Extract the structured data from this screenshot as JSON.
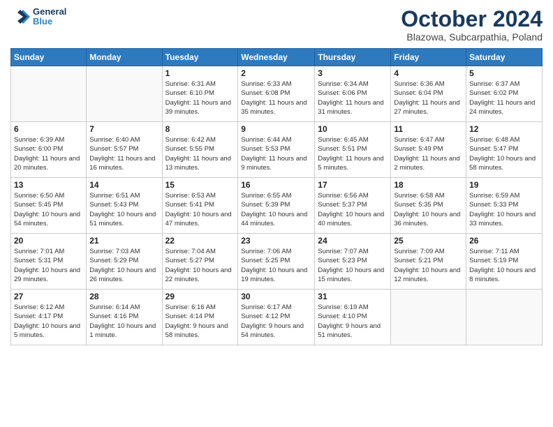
{
  "header": {
    "logo_line1": "General",
    "logo_line2": "Blue",
    "title": "October 2024",
    "location": "Blazowa, Subcarpathia, Poland"
  },
  "weekdays": [
    "Sunday",
    "Monday",
    "Tuesday",
    "Wednesday",
    "Thursday",
    "Friday",
    "Saturday"
  ],
  "weeks": [
    [
      {
        "day": "",
        "info": ""
      },
      {
        "day": "",
        "info": ""
      },
      {
        "day": "1",
        "info": "Sunrise: 6:31 AM\nSunset: 6:10 PM\nDaylight: 11 hours and 39 minutes."
      },
      {
        "day": "2",
        "info": "Sunrise: 6:33 AM\nSunset: 6:08 PM\nDaylight: 11 hours and 35 minutes."
      },
      {
        "day": "3",
        "info": "Sunrise: 6:34 AM\nSunset: 6:06 PM\nDaylight: 11 hours and 31 minutes."
      },
      {
        "day": "4",
        "info": "Sunrise: 6:36 AM\nSunset: 6:04 PM\nDaylight: 11 hours and 27 minutes."
      },
      {
        "day": "5",
        "info": "Sunrise: 6:37 AM\nSunset: 6:02 PM\nDaylight: 11 hours and 24 minutes."
      }
    ],
    [
      {
        "day": "6",
        "info": "Sunrise: 6:39 AM\nSunset: 6:00 PM\nDaylight: 11 hours and 20 minutes."
      },
      {
        "day": "7",
        "info": "Sunrise: 6:40 AM\nSunset: 5:57 PM\nDaylight: 11 hours and 16 minutes."
      },
      {
        "day": "8",
        "info": "Sunrise: 6:42 AM\nSunset: 5:55 PM\nDaylight: 11 hours and 13 minutes."
      },
      {
        "day": "9",
        "info": "Sunrise: 6:44 AM\nSunset: 5:53 PM\nDaylight: 11 hours and 9 minutes."
      },
      {
        "day": "10",
        "info": "Sunrise: 6:45 AM\nSunset: 5:51 PM\nDaylight: 11 hours and 5 minutes."
      },
      {
        "day": "11",
        "info": "Sunrise: 6:47 AM\nSunset: 5:49 PM\nDaylight: 11 hours and 2 minutes."
      },
      {
        "day": "12",
        "info": "Sunrise: 6:48 AM\nSunset: 5:47 PM\nDaylight: 10 hours and 58 minutes."
      }
    ],
    [
      {
        "day": "13",
        "info": "Sunrise: 6:50 AM\nSunset: 5:45 PM\nDaylight: 10 hours and 54 minutes."
      },
      {
        "day": "14",
        "info": "Sunrise: 6:51 AM\nSunset: 5:43 PM\nDaylight: 10 hours and 51 minutes."
      },
      {
        "day": "15",
        "info": "Sunrise: 6:53 AM\nSunset: 5:41 PM\nDaylight: 10 hours and 47 minutes."
      },
      {
        "day": "16",
        "info": "Sunrise: 6:55 AM\nSunset: 5:39 PM\nDaylight: 10 hours and 44 minutes."
      },
      {
        "day": "17",
        "info": "Sunrise: 6:56 AM\nSunset: 5:37 PM\nDaylight: 10 hours and 40 minutes."
      },
      {
        "day": "18",
        "info": "Sunrise: 6:58 AM\nSunset: 5:35 PM\nDaylight: 10 hours and 36 minutes."
      },
      {
        "day": "19",
        "info": "Sunrise: 6:59 AM\nSunset: 5:33 PM\nDaylight: 10 hours and 33 minutes."
      }
    ],
    [
      {
        "day": "20",
        "info": "Sunrise: 7:01 AM\nSunset: 5:31 PM\nDaylight: 10 hours and 29 minutes."
      },
      {
        "day": "21",
        "info": "Sunrise: 7:03 AM\nSunset: 5:29 PM\nDaylight: 10 hours and 26 minutes."
      },
      {
        "day": "22",
        "info": "Sunrise: 7:04 AM\nSunset: 5:27 PM\nDaylight: 10 hours and 22 minutes."
      },
      {
        "day": "23",
        "info": "Sunrise: 7:06 AM\nSunset: 5:25 PM\nDaylight: 10 hours and 19 minutes."
      },
      {
        "day": "24",
        "info": "Sunrise: 7:07 AM\nSunset: 5:23 PM\nDaylight: 10 hours and 15 minutes."
      },
      {
        "day": "25",
        "info": "Sunrise: 7:09 AM\nSunset: 5:21 PM\nDaylight: 10 hours and 12 minutes."
      },
      {
        "day": "26",
        "info": "Sunrise: 7:11 AM\nSunset: 5:19 PM\nDaylight: 10 hours and 8 minutes."
      }
    ],
    [
      {
        "day": "27",
        "info": "Sunrise: 6:12 AM\nSunset: 4:17 PM\nDaylight: 10 hours and 5 minutes."
      },
      {
        "day": "28",
        "info": "Sunrise: 6:14 AM\nSunset: 4:16 PM\nDaylight: 10 hours and 1 minute."
      },
      {
        "day": "29",
        "info": "Sunrise: 6:16 AM\nSunset: 4:14 PM\nDaylight: 9 hours and 58 minutes."
      },
      {
        "day": "30",
        "info": "Sunrise: 6:17 AM\nSunset: 4:12 PM\nDaylight: 9 hours and 54 minutes."
      },
      {
        "day": "31",
        "info": "Sunrise: 6:19 AM\nSunset: 4:10 PM\nDaylight: 9 hours and 51 minutes."
      },
      {
        "day": "",
        "info": ""
      },
      {
        "day": "",
        "info": ""
      }
    ]
  ]
}
